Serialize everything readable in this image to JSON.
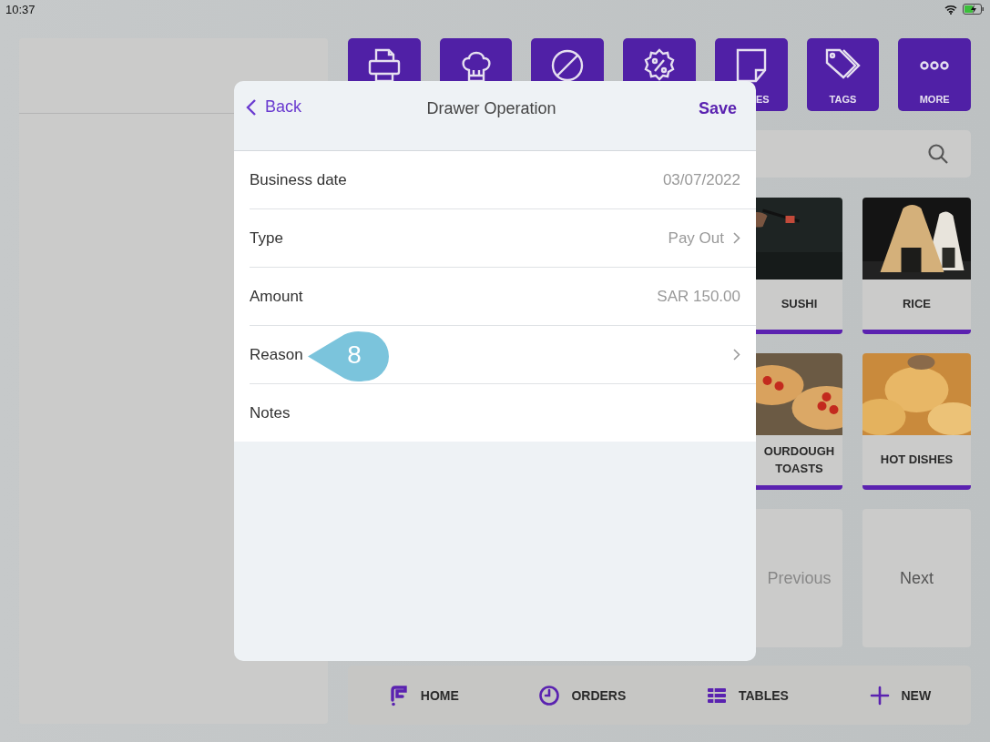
{
  "status_bar": {
    "time": "10:37"
  },
  "toolbar": [
    {
      "kind": "printer"
    },
    {
      "kind": "chef"
    },
    {
      "kind": "void"
    },
    {
      "kind": "discount"
    },
    {
      "kind": "note",
      "label": "ES"
    },
    {
      "kind": "tags",
      "label": "TAGS"
    },
    {
      "kind": "more",
      "label": "MORE"
    }
  ],
  "products": [
    {
      "name": "SUSHI"
    },
    {
      "name": "RICE"
    },
    {
      "name": "OURDOUGH TOASTS"
    },
    {
      "name": "HOT DISHES"
    }
  ],
  "pager": {
    "previous": "Previous",
    "next": "Next"
  },
  "bottom_nav": [
    {
      "label": "HOME"
    },
    {
      "label": "ORDERS"
    },
    {
      "label": "TABLES"
    },
    {
      "label": "NEW"
    }
  ],
  "modal": {
    "back": "Back",
    "title": "Drawer Operation",
    "save": "Save",
    "fields": [
      {
        "label": "Business date",
        "value": "03/07/2022",
        "chevron": false
      },
      {
        "label": "Type",
        "value": "Pay Out",
        "chevron": true
      },
      {
        "label": "Amount",
        "value": "SAR 150.00",
        "chevron": false
      },
      {
        "label": "Reason",
        "chevron": true
      },
      {
        "label": "Notes",
        "chevron": false
      }
    ]
  },
  "callout": {
    "number": "8"
  }
}
